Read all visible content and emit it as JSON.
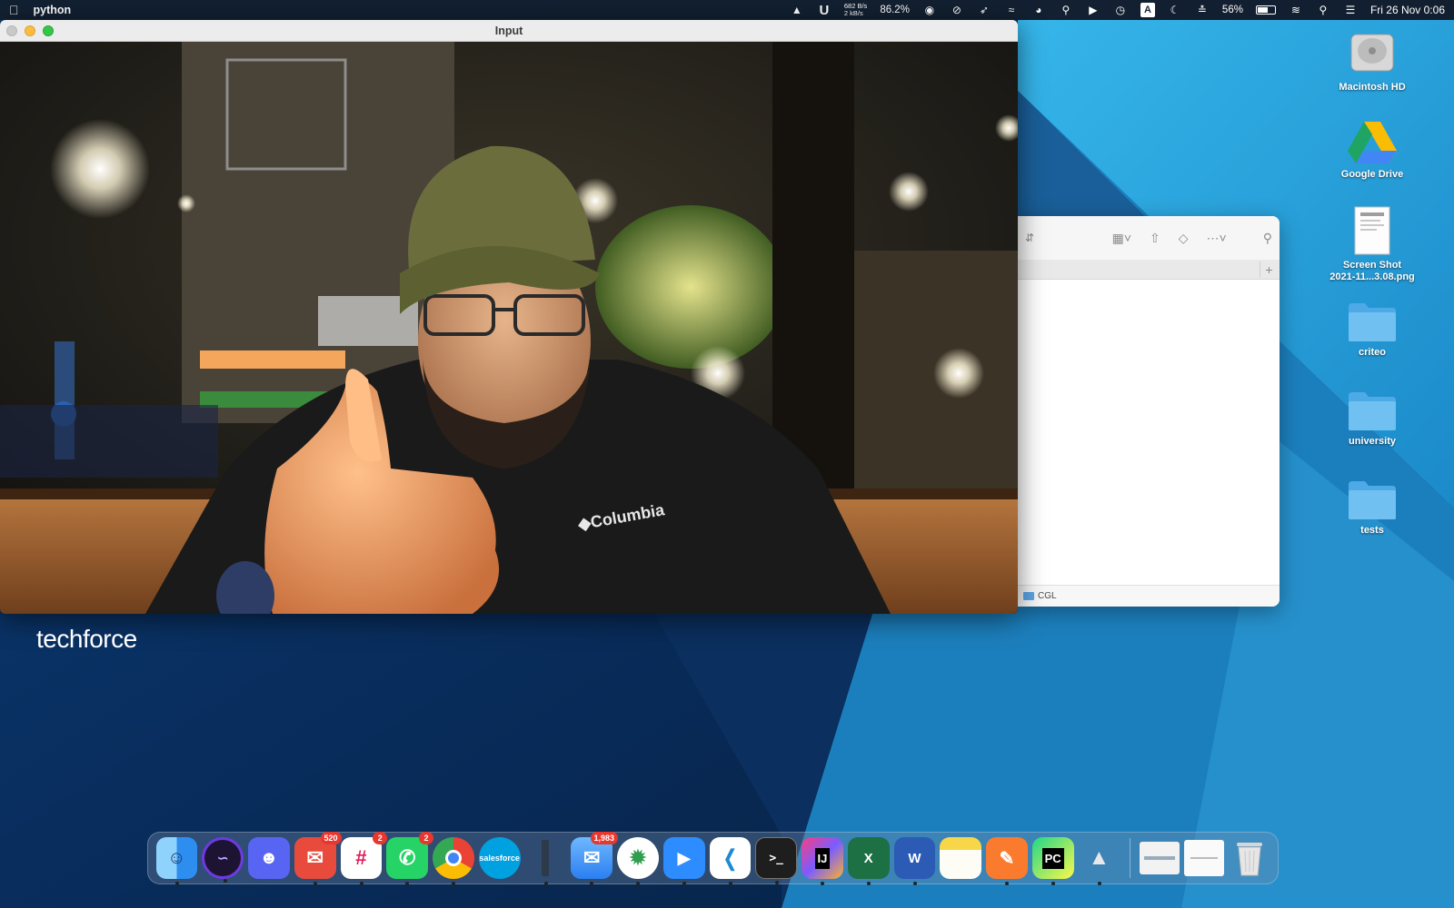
{
  "menubar": {
    "app_name": "python",
    "net_down": "682 B/s",
    "net_up": "2 kB/s",
    "cpu": "86.2%",
    "battery": "56%",
    "datetime": "Fri 26 Nov  0:06"
  },
  "input_window": {
    "title": "Input",
    "content": "webcam feed of a man giving a thumbs-up"
  },
  "finder": {
    "path_folder": "CGL"
  },
  "desktop_icons": [
    {
      "label": "Macintosh HD",
      "icon": "hard-drive-icon"
    },
    {
      "label": "Google Drive",
      "icon": "google-drive-icon"
    },
    {
      "label": "Screen Shot\n2021-11...3.08.png",
      "icon": "document-icon"
    },
    {
      "label": "criteo",
      "icon": "folder-icon"
    },
    {
      "label": "university",
      "icon": "folder-icon"
    },
    {
      "label": "tests",
      "icon": "folder-icon"
    }
  ],
  "wallpaper_logo": {
    "part1": "tech",
    "part2": "force"
  },
  "dock": {
    "apps": [
      {
        "name": "finder",
        "running": true
      },
      {
        "name": "insomnia",
        "running": true
      },
      {
        "name": "discord",
        "running": false
      },
      {
        "name": "mail-spark",
        "badge": "520",
        "running": true
      },
      {
        "name": "slack",
        "badge": "2",
        "running": true
      },
      {
        "name": "whatsapp",
        "badge": "2",
        "running": true
      },
      {
        "name": "chrome",
        "running": true
      },
      {
        "name": "salesforce",
        "label": "salesforce",
        "running": false
      },
      {
        "name": "dock-separator-app",
        "running": true
      },
      {
        "name": "mail",
        "badge": "1,983",
        "running": true
      },
      {
        "name": "network",
        "running": true
      },
      {
        "name": "zoom",
        "running": true
      },
      {
        "name": "vscode",
        "running": true
      },
      {
        "name": "terminal",
        "label": ">_",
        "running": true
      },
      {
        "name": "intellij",
        "label": "IJ",
        "running": true
      },
      {
        "name": "excel",
        "label": "X",
        "running": true
      },
      {
        "name": "word",
        "label": "W",
        "running": true
      },
      {
        "name": "notes",
        "running": false
      },
      {
        "name": "sketch",
        "running": true
      },
      {
        "name": "pycharm",
        "label": "PC",
        "running": true
      },
      {
        "name": "python-rocket",
        "running": true
      }
    ]
  },
  "colors": {
    "badge": "#e8372e",
    "wallpaper_dark": "#0a2c56",
    "wallpaper_light": "#2aa7e0"
  }
}
